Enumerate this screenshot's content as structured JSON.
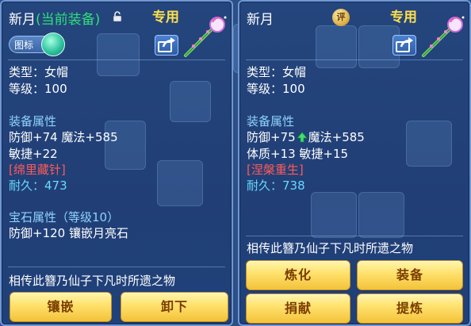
{
  "colors": {
    "panel_bg": "#213f76",
    "accent_gold": "#ffe04a",
    "green_sub": "#2fe07a",
    "section_blue": "#8fd3ff",
    "red": "#ff5a5a",
    "cyan": "#66d9ff",
    "button_text": "#7a3c00"
  },
  "left_panel": {
    "title": "新月",
    "title_sub": "(当前装备)",
    "tag": "专用",
    "toggle_label": "图标",
    "type_line": "类型：女帽",
    "level_line": "等级：100",
    "equip_attr_header": "装备属性",
    "attr_line1": "防御+74 魔法+585",
    "attr_line2": "敏捷+22",
    "special_name": "[绵里藏针]",
    "durability_label": "耐久：",
    "durability_value": "473",
    "gem_header": "宝石属性（等级10）",
    "gem_line": "防御+120 镶嵌月亮石",
    "description": "相传此簪乃仙子下凡时所遗之物",
    "buttons": [
      "镶嵌",
      "卸下"
    ],
    "icons": [
      "lock-icon",
      "share-icon",
      "hairpin-icon"
    ]
  },
  "right_panel": {
    "title": "新月",
    "appraise_badge": "评",
    "tag": "专用",
    "type_line": "类型：女帽",
    "level_line": "等级：100",
    "equip_attr_header": "装备属性",
    "attr_line1_a": "防御+75",
    "attr_line1_b": "魔法+585",
    "attr_line2": "体质+13 敏捷+15",
    "special_name": "[涅槃重生]",
    "durability_label": "耐久：",
    "durability_value": "738",
    "description": "相传此簪乃仙子下凡时所遗之物",
    "buttons": [
      "炼化",
      "装备",
      "捐献",
      "提炼"
    ],
    "icons": [
      "appraise-icon",
      "share-icon",
      "arrow-up-icon",
      "hairpin-icon"
    ]
  }
}
